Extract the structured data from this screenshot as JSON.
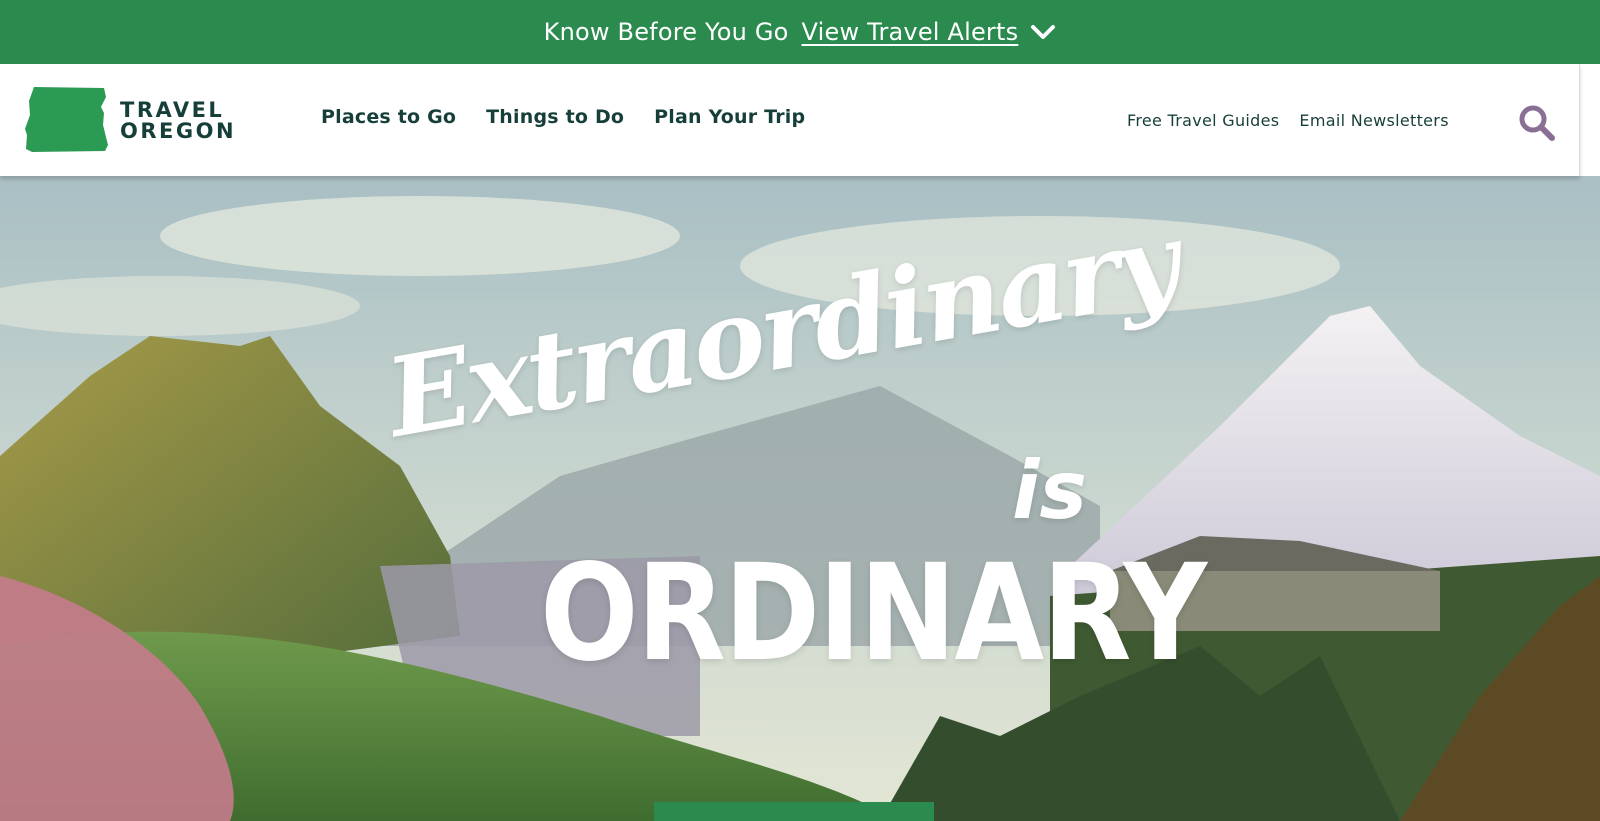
{
  "alert": {
    "lead": "Know Before You Go",
    "link": "View Travel Alerts"
  },
  "header": {
    "logo": {
      "line1": "TRAVEL",
      "line2": "OREGON",
      "icon": "oregon-state-shape-icon"
    },
    "main_nav": [
      "Places to Go",
      "Things to Do",
      "Plan Your Trip"
    ],
    "utility_nav": [
      "Free Travel Guides",
      "Email Newsletters"
    ],
    "search_icon": "search-icon"
  },
  "hero": {
    "title_line1": "Extraordinary",
    "title_line2": "is",
    "title_line3": "ORDINARY"
  },
  "colors": {
    "brand_green": "#2b8a4e",
    "nav_text": "#173f3a",
    "search_purple": "#8a6f94"
  }
}
